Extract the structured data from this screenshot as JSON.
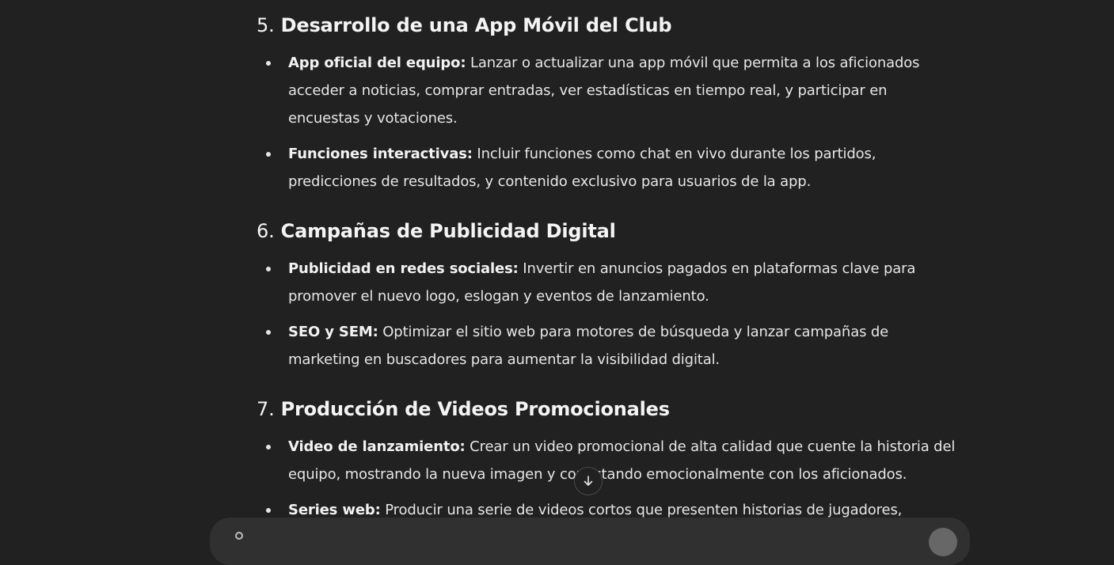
{
  "sections": [
    {
      "number": "5.",
      "title": "Desarrollo de una App Móvil del Club",
      "items": [
        {
          "label": "App oficial del equipo:",
          "text": " Lanzar o actualizar una app móvil que permita a los aficionados acceder a noticias, comprar entradas, ver estadísticas en tiempo real, y participar en encuestas y votaciones."
        },
        {
          "label": "Funciones interactivas:",
          "text": " Incluir funciones como chat en vivo durante los partidos, predicciones de resultados, y contenido exclusivo para usuarios de la app."
        }
      ]
    },
    {
      "number": "6.",
      "title": "Campañas de Publicidad Digital",
      "items": [
        {
          "label": "Publicidad en redes sociales:",
          "text": " Invertir en anuncios pagados en plataformas clave para promover el nuevo logo, eslogan y eventos de lanzamiento."
        },
        {
          "label": "SEO y SEM:",
          "text": " Optimizar el sitio web para motores de búsqueda y lanzar campañas de marketing en buscadores para aumentar la visibilidad digital."
        }
      ]
    },
    {
      "number": "7.",
      "title": "Producción de Videos Promocionales",
      "items": [
        {
          "label": "Video de lanzamiento:",
          "text": " Crear un video promocional de alta calidad que cuente la historia del equipo, mostrando la nueva imagen y conectando emocionalmente con los aficionados."
        },
        {
          "label": "Series web:",
          "text": " Producir una serie de videos cortos que presenten historias de jugadores,"
        }
      ]
    }
  ],
  "icons": {
    "scroll_down": "arrow-down-icon"
  }
}
